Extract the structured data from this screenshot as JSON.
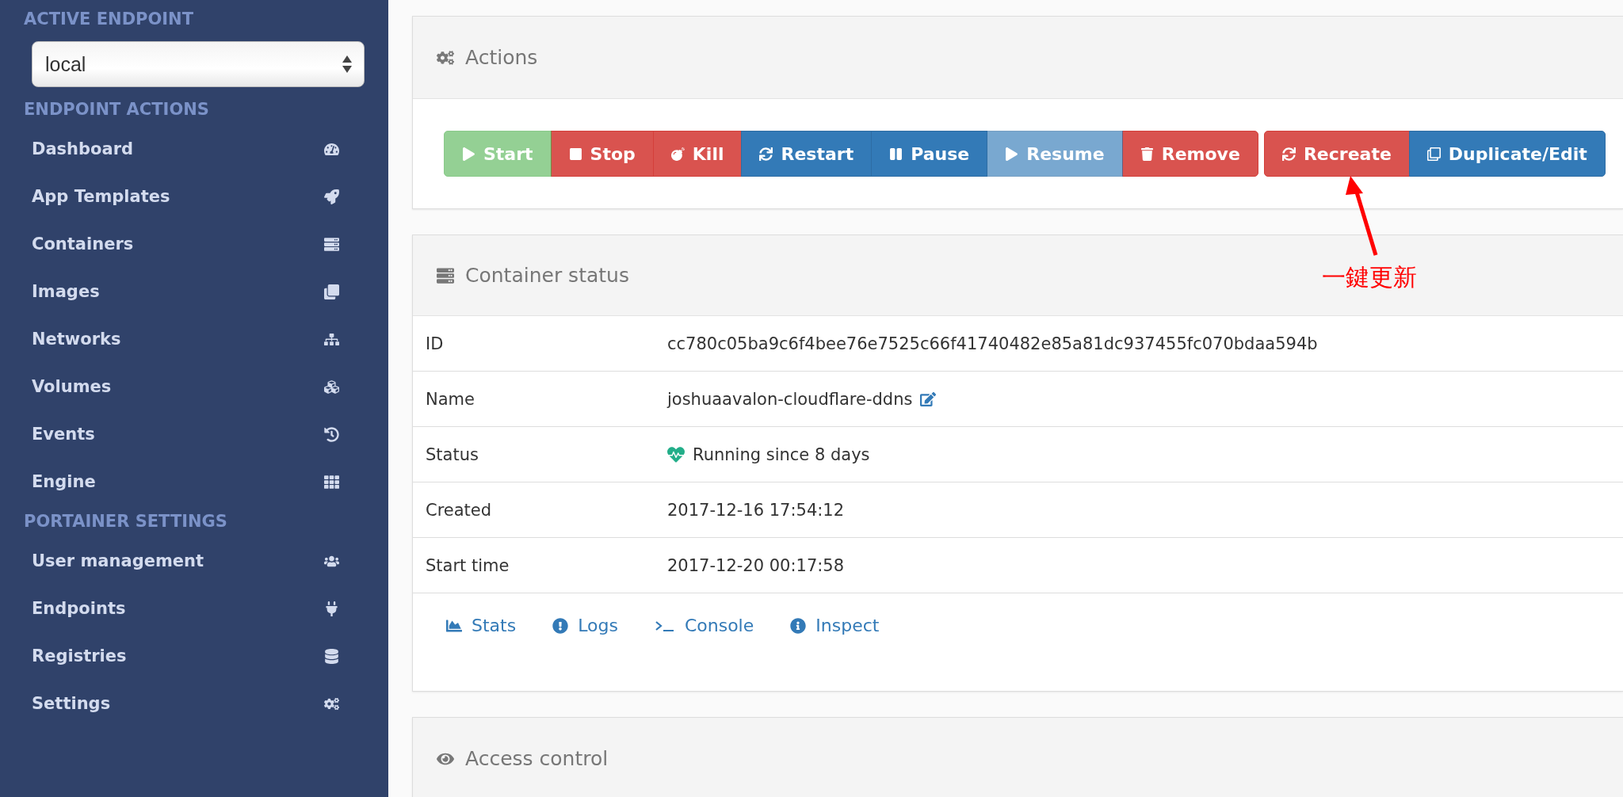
{
  "sidebar": {
    "sections": [
      {
        "title": "ACTIVE ENDPOINT",
        "kind": "select",
        "value": "local"
      },
      {
        "title": "ENDPOINT ACTIONS",
        "kind": "menu",
        "items": [
          {
            "label": "Dashboard"
          },
          {
            "label": "App Templates"
          },
          {
            "label": "Containers"
          },
          {
            "label": "Images"
          },
          {
            "label": "Networks"
          },
          {
            "label": "Volumes"
          },
          {
            "label": "Events"
          },
          {
            "label": "Engine"
          }
        ]
      },
      {
        "title": "PORTAINER SETTINGS",
        "kind": "menu",
        "items": [
          {
            "label": "User management"
          },
          {
            "label": "Endpoints"
          },
          {
            "label": "Registries"
          },
          {
            "label": "Settings"
          }
        ]
      }
    ]
  },
  "actions": {
    "title": "Actions",
    "groups": [
      [
        {
          "label": "Start",
          "kind": "success",
          "disabled": true
        },
        {
          "label": "Stop",
          "kind": "danger",
          "disabled": false
        },
        {
          "label": "Kill",
          "kind": "danger",
          "disabled": false
        },
        {
          "label": "Restart",
          "kind": "primary",
          "disabled": false
        },
        {
          "label": "Pause",
          "kind": "primary",
          "disabled": false
        },
        {
          "label": "Resume",
          "kind": "primary",
          "disabled": true
        },
        {
          "label": "Remove",
          "kind": "danger",
          "disabled": false
        }
      ],
      [
        {
          "label": "Recreate",
          "kind": "danger",
          "disabled": false
        },
        {
          "label": "Duplicate/Edit",
          "kind": "primary",
          "disabled": false
        }
      ]
    ]
  },
  "annotation": {
    "text": "一鍵更新"
  },
  "container_status": {
    "title": "Container status",
    "rows": [
      {
        "label": "ID",
        "value": "cc780c05ba9c6f4bee76e7525c66f41740482e85a81dc937455fc070bdaa594b"
      },
      {
        "label": "Name",
        "value": "joshuaavalon-cloudflare-ddns"
      },
      {
        "label": "Status",
        "value": "Running since 8 days"
      },
      {
        "label": "Created",
        "value": "2017-12-16 17:54:12"
      },
      {
        "label": "Start time",
        "value": "2017-12-20 00:17:58"
      }
    ],
    "links": [
      "Stats",
      "Logs",
      "Console",
      "Inspect"
    ]
  },
  "access_control": {
    "title": "Access control"
  }
}
